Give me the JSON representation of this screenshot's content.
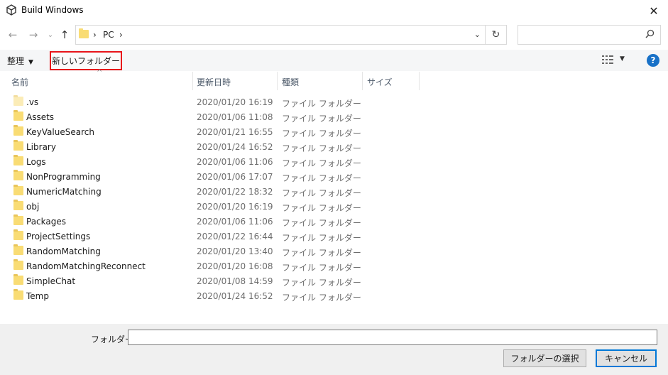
{
  "window": {
    "title": "Build Windows",
    "close_glyph": "✕"
  },
  "nav": {
    "back_glyph": "←",
    "forward_glyph": "→",
    "recent_glyph": "⌄",
    "up_glyph": "↑",
    "breadcrumb_sep": "›",
    "breadcrumb_pc": "PC",
    "breadcrumb_sep2": "›",
    "dropdown_glyph": "⌄",
    "refresh_glyph": "↻",
    "search_placeholder": "",
    "search_glyph": "⚲"
  },
  "toolbar": {
    "organize_label": "整理",
    "organize_arrow": "▼",
    "new_folder_label": "新しいフォルダー",
    "view_glyph": "☷☷",
    "view_arrow": "▼",
    "help_glyph": "?"
  },
  "columns": {
    "name": "名前",
    "date": "更新日時",
    "type": "種類",
    "size": "サイズ",
    "sort_glyph": "^"
  },
  "files": [
    {
      "name": ".vs",
      "date": "2020/01/20 16:19",
      "type": "ファイル フォルダー",
      "faded": true
    },
    {
      "name": "Assets",
      "date": "2020/01/06 11:08",
      "type": "ファイル フォルダー"
    },
    {
      "name": "KeyValueSearch",
      "date": "2020/01/21 16:55",
      "type": "ファイル フォルダー"
    },
    {
      "name": "Library",
      "date": "2020/01/24 16:52",
      "type": "ファイル フォルダー"
    },
    {
      "name": "Logs",
      "date": "2020/01/06 11:06",
      "type": "ファイル フォルダー"
    },
    {
      "name": "NonProgramming",
      "date": "2020/01/06 17:07",
      "type": "ファイル フォルダー"
    },
    {
      "name": "NumericMatching",
      "date": "2020/01/22 18:32",
      "type": "ファイル フォルダー"
    },
    {
      "name": "obj",
      "date": "2020/01/20 16:19",
      "type": "ファイル フォルダー"
    },
    {
      "name": "Packages",
      "date": "2020/01/06 11:06",
      "type": "ファイル フォルダー"
    },
    {
      "name": "ProjectSettings",
      "date": "2020/01/22 16:44",
      "type": "ファイル フォルダー"
    },
    {
      "name": "RandomMatching",
      "date": "2020/01/20 13:40",
      "type": "ファイル フォルダー"
    },
    {
      "name": "RandomMatchingReconnect",
      "date": "2020/01/20 16:08",
      "type": "ファイル フォルダー"
    },
    {
      "name": "SimpleChat",
      "date": "2020/01/08 14:59",
      "type": "ファイル フォルダー"
    },
    {
      "name": "Temp",
      "date": "2020/01/24 16:52",
      "type": "ファイル フォルダー"
    }
  ],
  "footer": {
    "folder_label": "フォルダー:",
    "folder_value": "",
    "select_button": "フォルダーの選択",
    "cancel_button": "キャンセル"
  },
  "colors": {
    "highlight_border": "#e8141a",
    "folder_yellow": "#f9dc74",
    "help_blue": "#1871c7",
    "default_button_border": "#0078d7"
  }
}
